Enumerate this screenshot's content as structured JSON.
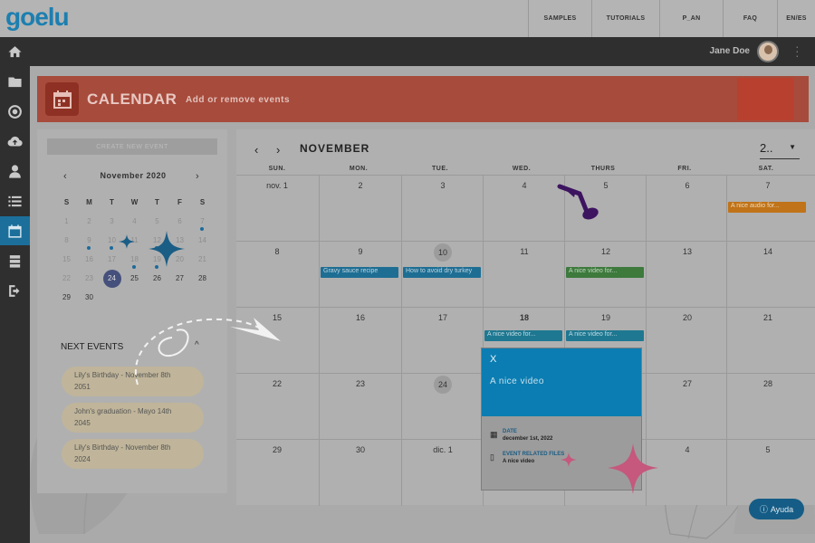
{
  "brand": {
    "logo_text": "goelu"
  },
  "topnav": {
    "items": [
      "SAMPLES",
      "TUTORIALS",
      "P_AN",
      "FAQ"
    ],
    "lang_en": "EN",
    "lang_sep": "/",
    "lang_es": "ES"
  },
  "user": {
    "name": "Jane Doe"
  },
  "rail": {
    "items": [
      "home",
      "folder",
      "target",
      "cloud-upload",
      "user",
      "list",
      "calendar",
      "archive",
      "logout"
    ],
    "active": "calendar"
  },
  "header": {
    "title": "CALENDAR",
    "subtitle": "Add or remove events"
  },
  "sidebar": {
    "create_button": "CREATE NEW EVENT",
    "mini_calendar": {
      "month_label": "November 2020",
      "prev": "‹",
      "next": "›",
      "weekday_headers": [
        "S",
        "M",
        "T",
        "W",
        "T",
        "F",
        "S"
      ],
      "rows": [
        [
          "1",
          "2",
          "3",
          "4",
          "5",
          "6",
          "7"
        ],
        [
          "8",
          "9",
          "10",
          "11",
          "12",
          "13",
          "14"
        ],
        [
          "15",
          "16",
          "17",
          "18",
          "19",
          "20",
          "21"
        ],
        [
          "22",
          "23",
          "24",
          "25",
          "26",
          "27",
          "28"
        ],
        [
          "29",
          "30",
          "",
          "",
          "",
          "",
          ""
        ]
      ],
      "selected_day": "24"
    },
    "next_events": {
      "title": "NEXT EVENTS",
      "items": [
        {
          "line1": "Lily's Birthday - November 8th",
          "line2": "2051"
        },
        {
          "line1": "John's graduation - Mayo 14th",
          "line2": "2045"
        },
        {
          "line1": "Lily's Birthday - November 8th",
          "line2": "2024"
        }
      ]
    }
  },
  "calendar": {
    "prev": "‹",
    "next": "›",
    "month": "NOVEMBER",
    "year_select": "2..",
    "weekdays": [
      "SUN.",
      "MON.",
      "TUE.",
      "WED.",
      "THURS",
      "FRI.",
      "SAT."
    ],
    "weeks": [
      [
        "nov. 1",
        "2",
        "3",
        "4",
        "5",
        "6",
        "7"
      ],
      [
        "8",
        "9",
        "10",
        "11",
        "12",
        "13",
        "14"
      ],
      [
        "15",
        "16",
        "17",
        "18",
        "19",
        "20",
        "21"
      ],
      [
        "22",
        "23",
        "24",
        "25",
        "26",
        "27",
        "28"
      ],
      [
        "29",
        "30",
        "dic. 1",
        "2",
        "3",
        "4",
        "5"
      ]
    ],
    "events": {
      "sat7": "A nice audio for...",
      "mon9": "Gravy sauce recipe",
      "tue10": "How to avoid dry turkey",
      "thu12": "A nice video for...",
      "wed18": "A nice video for...",
      "thu19": "A nice video for..."
    },
    "event_colors": {
      "blue": "#1e6e94",
      "green": "#3d7a3c",
      "orange": "#c07318",
      "teal": "#1f7891"
    }
  },
  "popup": {
    "close": "X",
    "title": "A nice video",
    "date_label": "DATE",
    "date_value": "december 1st, 2022",
    "files_label": "EVENT RELATED FILES",
    "files_value": "A nice video"
  },
  "help": {
    "label": "Ayuda"
  }
}
